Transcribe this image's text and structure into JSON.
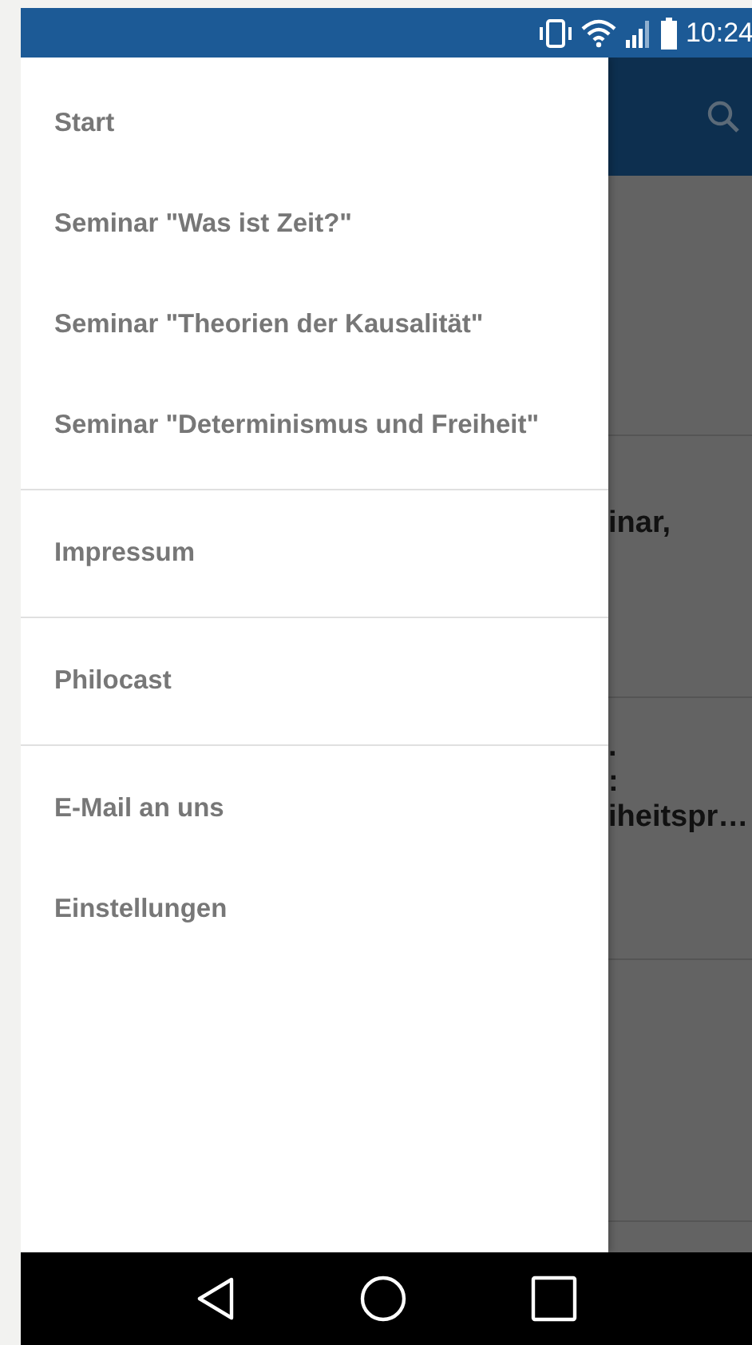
{
  "status_bar": {
    "time": "10:24"
  },
  "drawer": {
    "groups": [
      {
        "items": [
          "Start",
          "Seminar \"Was ist Zeit?\"",
          "Seminar \"Theorien der Kausalität\"",
          "Seminar \"Determinismus und Freiheit\""
        ]
      },
      {
        "items": [
          "Impressum"
        ]
      },
      {
        "items": [
          "Philocast"
        ]
      },
      {
        "items": [
          "E-Mail an uns",
          "Einstellungen"
        ]
      }
    ]
  },
  "content": {
    "cards": [
      {
        "kind": "blank"
      },
      {
        "kind": "text",
        "lines": [
          "inar,"
        ]
      },
      {
        "kind": "text",
        "lines": [
          ".",
          ":",
          "iheitspr…"
        ]
      },
      {
        "kind": "blank"
      }
    ]
  }
}
